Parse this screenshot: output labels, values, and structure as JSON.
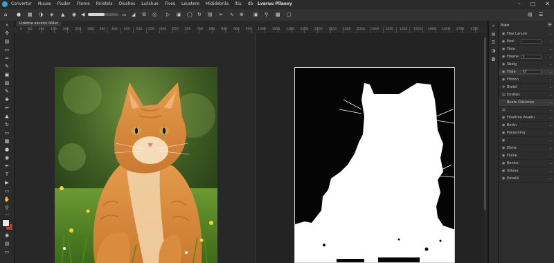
{
  "menubar": {
    "items": [
      "Convertor",
      "Nuuse",
      "Piuder",
      "Fteme",
      "Rnistels",
      "Oioshes",
      "Lulishue",
      "Fives",
      "Leustere",
      "Mididebrila",
      "Itiu",
      "db"
    ],
    "title": "Lvaruu Pllaevy"
  },
  "document": {
    "tab_label": "Ltdefcle ekuinto 0ll4er",
    "ruler_labels": [
      "0",
      "50",
      "100",
      "150",
      "200",
      "250",
      "300",
      "350",
      "400",
      "450",
      "500",
      "550",
      "600",
      "650",
      "700",
      "750",
      "800",
      "850",
      "900",
      "950",
      "1000",
      "1050",
      "1100",
      "1150",
      "1200",
      "1250",
      "1300",
      "1350",
      "1400",
      "1450",
      "1500",
      "1550",
      "1600",
      "1650",
      "1700",
      "1750"
    ],
    "left_image": "photograph of an orange tabby cat sitting on grass with yellow flowers",
    "right_image": "black and white layer mask silhouette of the cat"
  },
  "panel": {
    "tab": "Pute",
    "rows": [
      {
        "icon": "eye-icon",
        "label": "Flee Lanure",
        "value": "",
        "selected": false
      },
      {
        "icon": "eye-icon",
        "label": "Eeel",
        "value": "-",
        "selected": false
      },
      {
        "icon": "eye-icon",
        "label": "Yinle",
        "value": "",
        "selected": false
      },
      {
        "icon": "eye-icon",
        "label": "Eleane",
        "value": "1",
        "selected": false
      },
      {
        "icon": "eye-icon",
        "label": "Sbelg",
        "value": "",
        "selected": false
      },
      {
        "icon": "eye-icon",
        "label": "Ttaie",
        "value": "47",
        "selected": true
      },
      {
        "icon": "eye-icon",
        "label": "Ftiloon",
        "value": "",
        "selected": false
      },
      {
        "icon": "gear-icon",
        "label": "Brelel",
        "value": "",
        "selected": false
      },
      {
        "icon": "layer-icon",
        "label": "Ensikes",
        "value": "",
        "selected": false
      },
      {
        "icon": "",
        "label": "Beete Gltciones",
        "value": "",
        "selected": true
      },
      {
        "icon": "layer-icon",
        "label": "",
        "value": "",
        "selected": false
      },
      {
        "icon": "eye-icon",
        "label": "Finaltrne Pesetu",
        "value": "",
        "selected": false
      },
      {
        "icon": "eye-icon",
        "label": "Bostn",
        "value": "",
        "selected": false
      },
      {
        "icon": "eye-icon",
        "label": "Porsenting",
        "value": "",
        "selected": false
      },
      {
        "icon": "eye-icon",
        "label": "",
        "value": "",
        "selected": false
      },
      {
        "icon": "eye-icon",
        "label": "Elirila",
        "value": "",
        "selected": false
      },
      {
        "icon": "eye-icon",
        "label": "Fiuine",
        "value": "",
        "selected": false
      },
      {
        "icon": "eye-icon",
        "label": "Bonios",
        "value": "",
        "selected": false
      },
      {
        "icon": "eye-icon",
        "label": "Gtioue",
        "value": "",
        "selected": false
      },
      {
        "icon": "eye-icon",
        "label": "Eoseilli",
        "value": "",
        "selected": false
      }
    ]
  },
  "colors": {
    "foreground": "#e8e8e8",
    "background": "#c63a2a"
  }
}
